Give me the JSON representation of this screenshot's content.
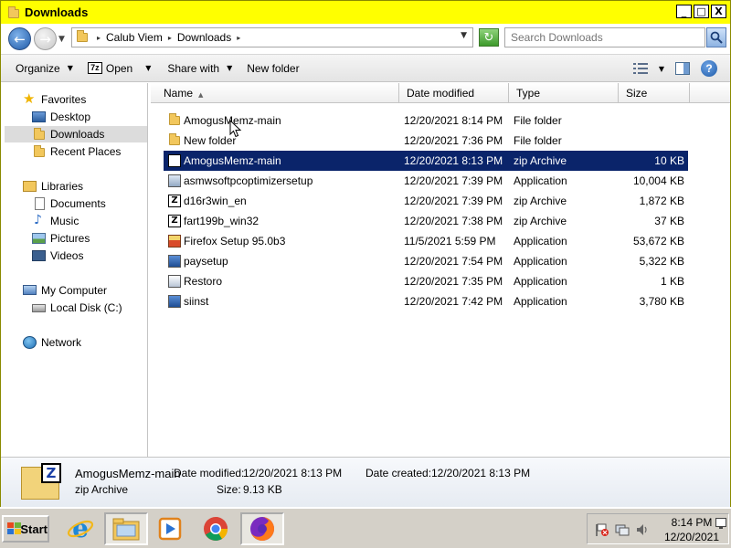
{
  "window": {
    "title": "Downloads",
    "minimize_label": "_",
    "maximize_label": "□",
    "close_label": "X"
  },
  "address_bar": {
    "crumbs": [
      "Calub Viem",
      "Downloads"
    ],
    "crumb_separator": "▸",
    "search_placeholder": "Search Downloads"
  },
  "toolbar": {
    "organize": "Organize",
    "open_prefix": "7z",
    "open": "Open",
    "share_with": "Share with",
    "new_folder": "New folder",
    "help": "?"
  },
  "nav_pane": {
    "favorites": "Favorites",
    "desktop": "Desktop",
    "downloads": "Downloads",
    "recent_places": "Recent Places",
    "libraries": "Libraries",
    "documents": "Documents",
    "music": "Music",
    "pictures": "Pictures",
    "videos": "Videos",
    "my_computer": "My Computer",
    "local_disk": "Local Disk (C:)",
    "network": "Network"
  },
  "columns": {
    "name": "Name",
    "date_modified": "Date modified",
    "type": "Type",
    "size": "Size"
  },
  "files": [
    {
      "name": "AmogusMemz-main",
      "date": "12/20/2021 8:14 PM",
      "type": "File folder",
      "size": "",
      "icon": "folder-icon"
    },
    {
      "name": "New folder",
      "date": "12/20/2021 7:36 PM",
      "type": "File folder",
      "size": "",
      "icon": "folder-icon"
    },
    {
      "name": "AmogusMemz-main",
      "date": "12/20/2021 8:13 PM",
      "type": "zip Archive",
      "size": "10 KB",
      "icon": "zip-archive-icon"
    },
    {
      "name": "asmwsoftpcoptimizersetup",
      "date": "12/20/2021 7:39 PM",
      "type": "Application",
      "size": "10,004 KB",
      "icon": "installer-icon"
    },
    {
      "name": "d16r3win_en",
      "date": "12/20/2021 7:39 PM",
      "type": "zip Archive",
      "size": "1,872 KB",
      "icon": "zip-archive-icon"
    },
    {
      "name": "fart199b_win32",
      "date": "12/20/2021 7:38 PM",
      "type": "zip Archive",
      "size": "37 KB",
      "icon": "zip-archive-icon"
    },
    {
      "name": "Firefox Setup 95.0b3",
      "date": "11/5/2021 5:59 PM",
      "type": "Application",
      "size": "53,672 KB",
      "icon": "firefox-installer-icon"
    },
    {
      "name": "paysetup",
      "date": "12/20/2021 7:54 PM",
      "type": "Application",
      "size": "5,322 KB",
      "icon": "setup-icon"
    },
    {
      "name": "Restoro",
      "date": "12/20/2021 7:35 PM",
      "type": "Application",
      "size": "1 KB",
      "icon": "application-icon"
    },
    {
      "name": "siinst",
      "date": "12/20/2021 7:42 PM",
      "type": "Application",
      "size": "3,780 KB",
      "icon": "setup-icon"
    }
  ],
  "selected_index": 2,
  "details": {
    "name": "AmogusMemz-main",
    "type": "zip Archive",
    "date_modified_label": "Date modified:",
    "date_modified": "12/20/2021 8:13 PM",
    "date_created_label": "Date created:",
    "date_created": "12/20/2021 8:13 PM",
    "size_label": "Size:",
    "size": "9.13 KB",
    "icon_letter": "Z"
  },
  "taskbar": {
    "start": "Start",
    "time": "8:14 PM",
    "date": "12/20/2021"
  },
  "colors": {
    "titlebar": "#ffff00",
    "selection": "#0a246a",
    "taskbar": "#d4d0c8"
  }
}
